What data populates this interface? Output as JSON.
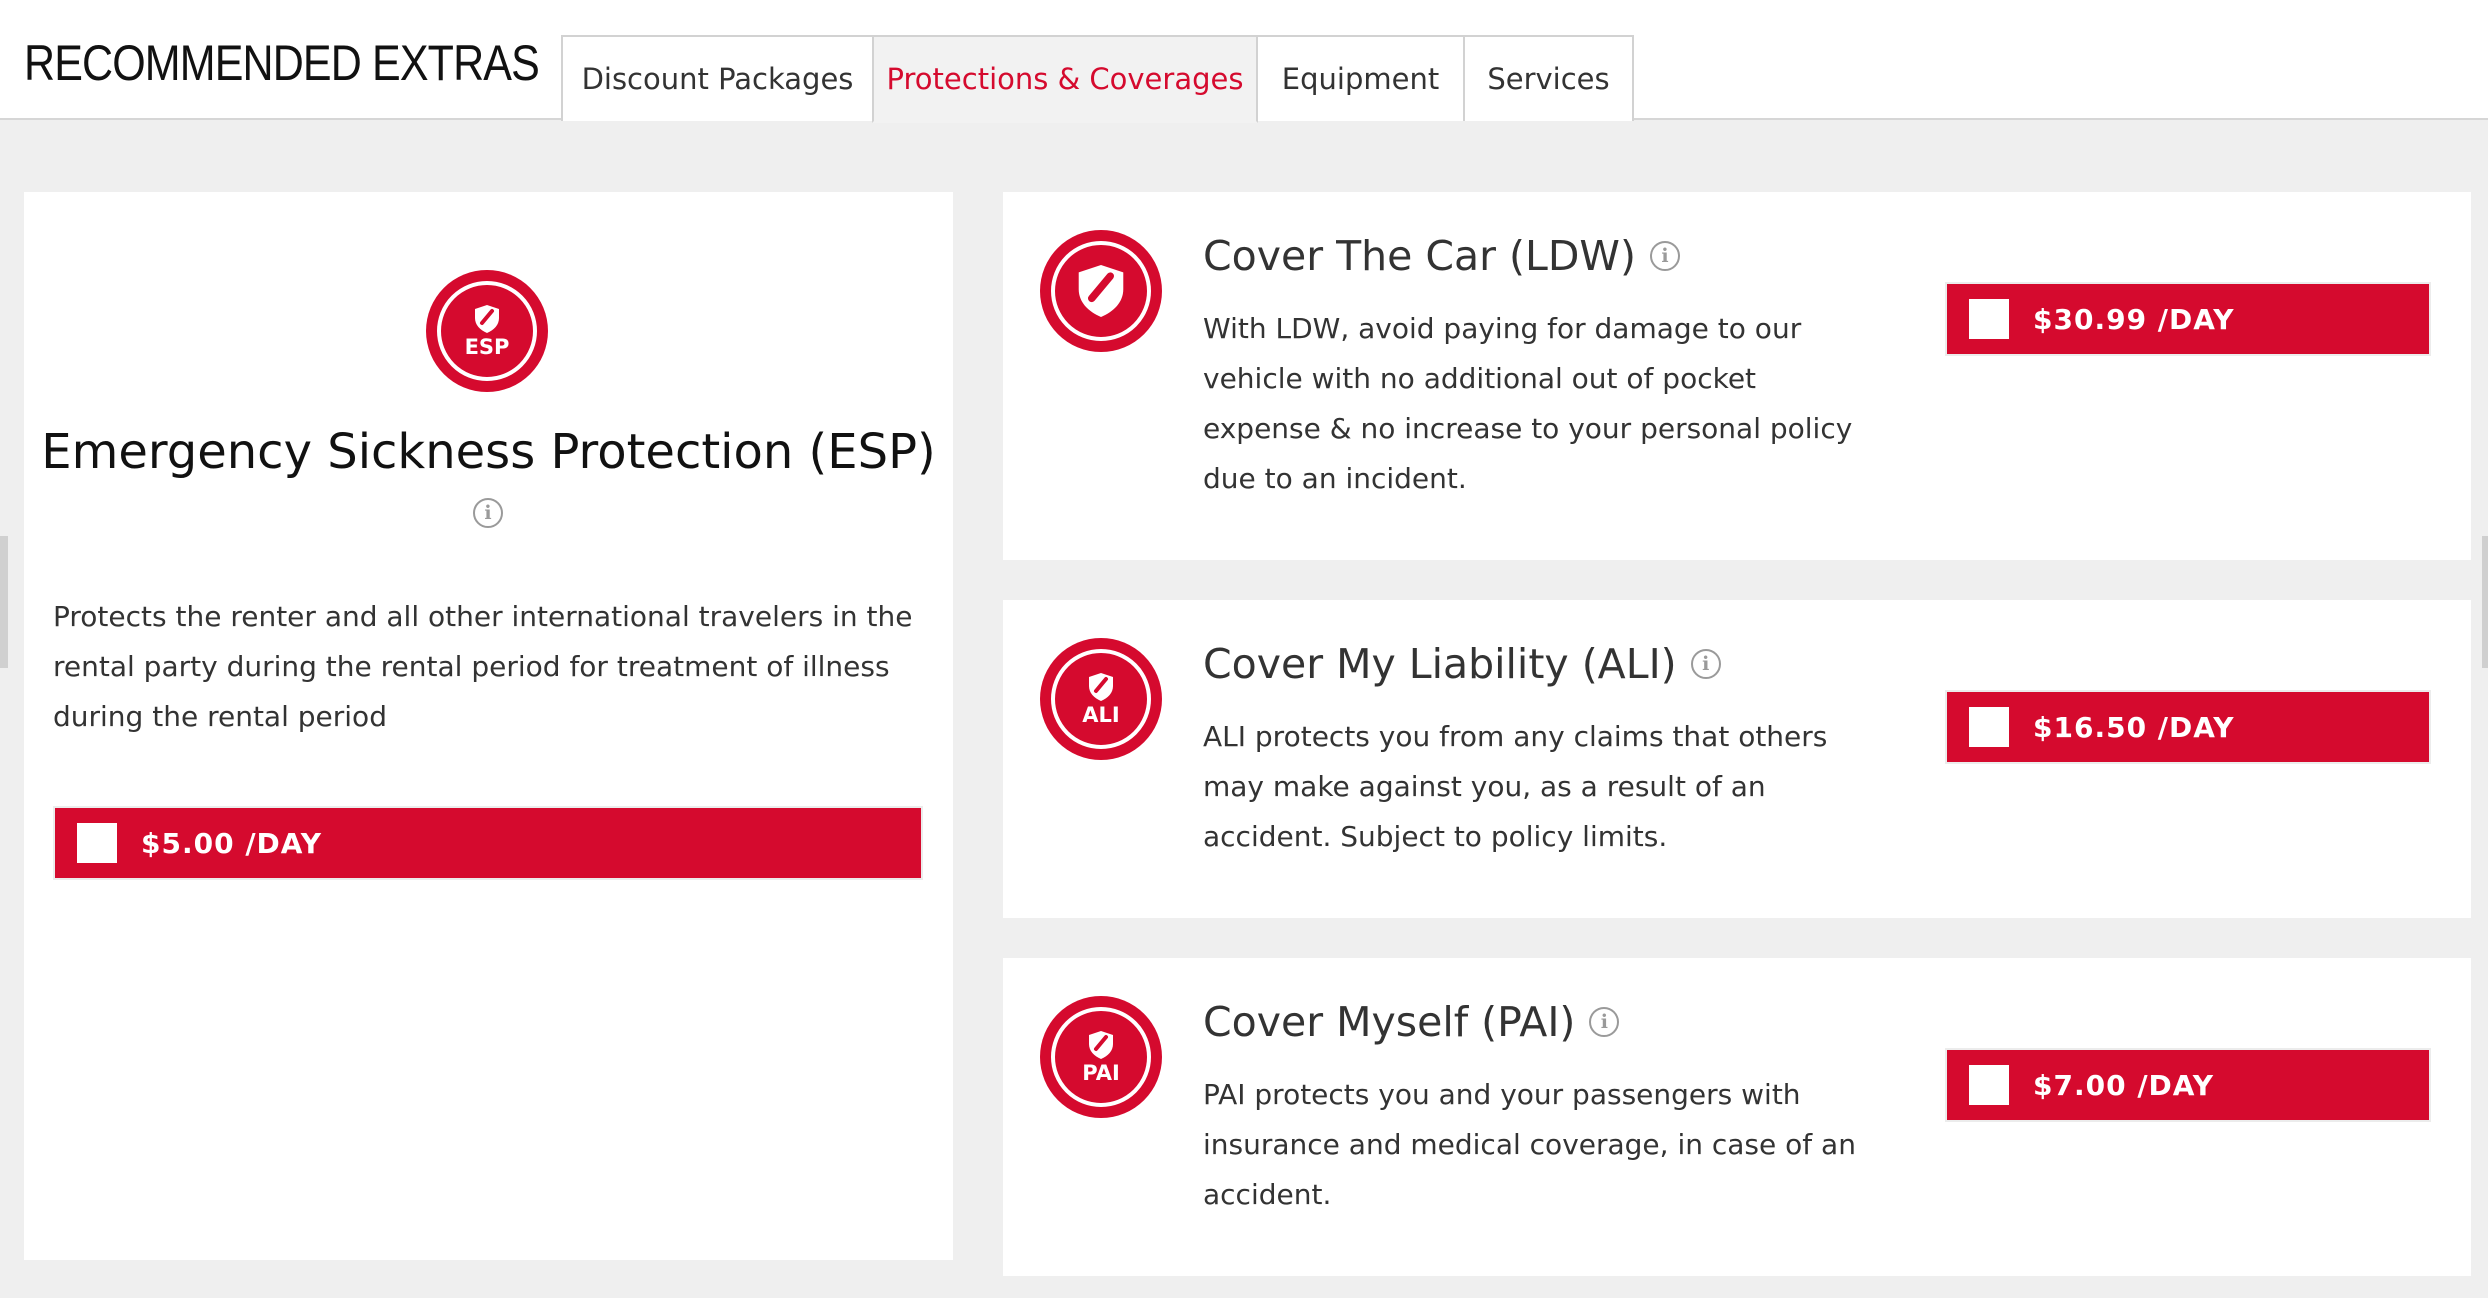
{
  "header": {
    "title": "RECOMMENDED EXTRAS",
    "tabs": [
      {
        "label": "Discount Packages",
        "active": false
      },
      {
        "label": "Protections & Coverages",
        "active": true
      },
      {
        "label": "Equipment",
        "active": false
      },
      {
        "label": "Services",
        "active": false
      }
    ]
  },
  "colors": {
    "accent": "#d50a2e",
    "background": "#efefef",
    "card": "#ffffff",
    "text": "#333333"
  },
  "esp": {
    "badge_code": "ESP",
    "badge_icon": "shield-icon",
    "title": "Emergency Sickness Protection (ESP)",
    "info_icon": "info-icon",
    "description": "Protects the renter and all other international travelers in the rental party during the rental period for treatment of illness during the rental period",
    "price_label": "$5.00 /DAY",
    "selected": false
  },
  "protections": [
    {
      "badge_code": "",
      "badge_icon": "shield-icon",
      "title": "Cover The Car (LDW)",
      "description": "With LDW, avoid paying for damage to our vehicle with no additional out of pocket expense & no increase to your personal policy due to an incident.",
      "price_label": "$30.99 /DAY",
      "selected": false
    },
    {
      "badge_code": "ALI",
      "badge_icon": "shield-icon",
      "title": "Cover My Liability (ALI)",
      "description": "ALI protects you from any claims that others may make against you, as a result of an accident. Subject to policy limits.",
      "price_label": "$16.50 /DAY",
      "selected": false
    },
    {
      "badge_code": "PAI",
      "badge_icon": "shield-icon",
      "title": "Cover Myself (PAI)",
      "description": "PAI protects you and your passengers with insurance and medical coverage, in case of an accident.",
      "price_label": "$7.00 /DAY",
      "selected": false
    }
  ]
}
